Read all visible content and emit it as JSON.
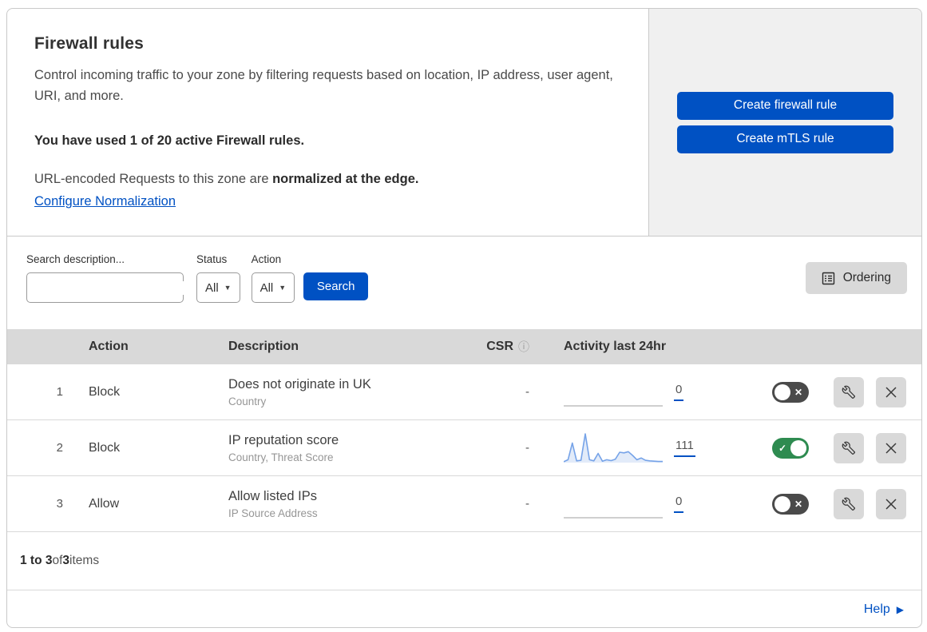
{
  "header": {
    "title": "Firewall rules",
    "description": "Control incoming traffic to your zone by filtering requests based on location, IP address, user agent, URI, and more.",
    "usage_text": "You have used 1 of 20 active Firewall rules.",
    "normalization_prefix": "URL-encoded Requests to this zone are ",
    "normalization_bold": "normalized at the edge.",
    "normalization_link": "Configure Normalization",
    "create_firewall_button": "Create firewall rule",
    "create_mtls_button": "Create mTLS rule"
  },
  "filters": {
    "search_label": "Search description...",
    "search_value": "",
    "status_label": "Status",
    "status_value": "All",
    "action_label": "Action",
    "action_value": "All",
    "search_button": "Search",
    "ordering_button": "Ordering"
  },
  "table": {
    "columns": {
      "action": "Action",
      "description": "Description",
      "csr": "CSR",
      "activity": "Activity last 24hr"
    },
    "rows": [
      {
        "number": "1",
        "action": "Block",
        "description": "Does not originate in UK",
        "criteria": "Country",
        "csr": "-",
        "activity_count": "0",
        "enabled": false,
        "sparkline": []
      },
      {
        "number": "2",
        "action": "Block",
        "description": "IP reputation score",
        "criteria": "Country, Threat Score",
        "csr": "-",
        "activity_count": "111",
        "enabled": true,
        "sparkline": [
          3,
          10,
          68,
          6,
          8,
          100,
          10,
          6,
          32,
          5,
          10,
          7,
          12,
          36,
          34,
          38,
          25,
          10,
          16,
          8,
          6,
          5,
          4,
          4
        ]
      },
      {
        "number": "3",
        "action": "Allow",
        "description": "Allow listed IPs",
        "criteria": "IP Source Address",
        "csr": "-",
        "activity_count": "0",
        "enabled": false,
        "sparkline": []
      }
    ]
  },
  "footer": {
    "range_bold": "1 to 3",
    "of_text": " of ",
    "total_bold": "3",
    "items_text": " items",
    "help_label": "Help"
  },
  "icons": {
    "search": "magnifier-icon",
    "csr_info": "info-circle-icon",
    "ordering": "ordered-list-icon",
    "toggle_on": "check-icon",
    "toggle_off": "x-icon",
    "edit": "wrench-icon",
    "delete": "x-icon",
    "help": "arrow-right-icon"
  },
  "colors": {
    "accent_blue": "#0051c3",
    "toggle_on_green": "#2e8b50",
    "toggle_off_gray": "#4a4a4a",
    "sparkline_line": "#76a3e8",
    "sparkline_fill": "#dbe6f7",
    "flatline_gray": "#bfbfbf",
    "panel_gray": "#f0f0f0",
    "table_header_gray": "#d9d9d9"
  }
}
